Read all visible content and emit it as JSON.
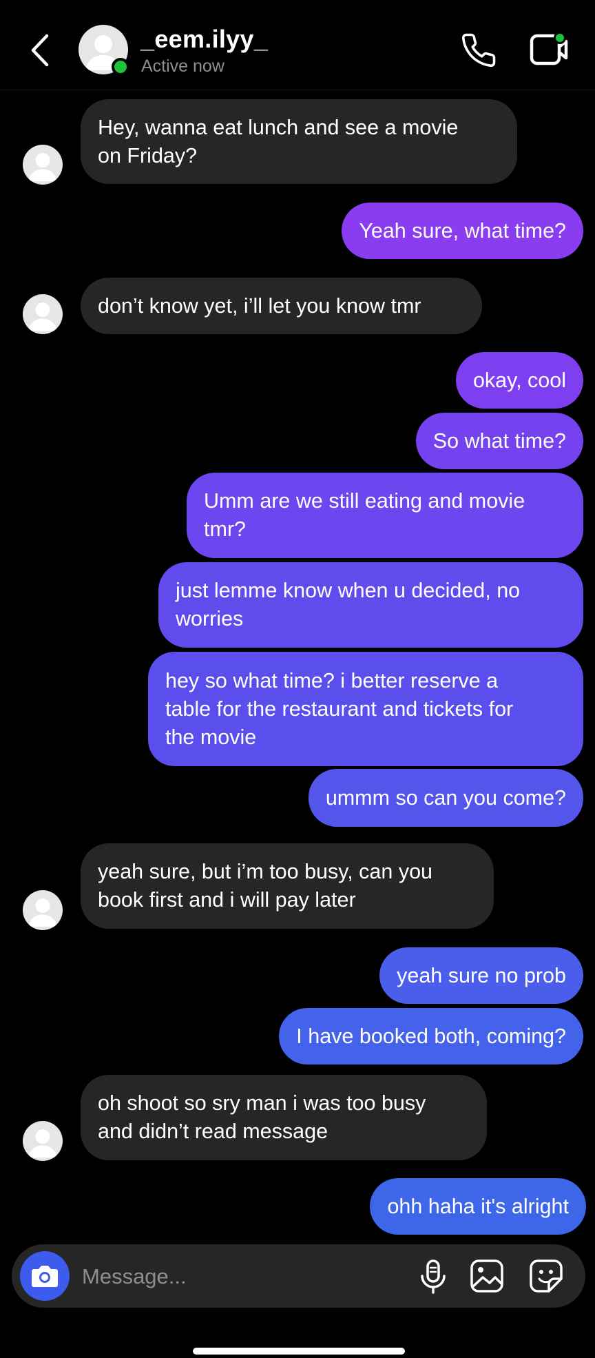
{
  "header": {
    "back_icon": "chevron-left-icon",
    "username": "_eem.ilyy_",
    "status": "Active now",
    "call_icon": "phone-icon",
    "video_icon": "video-camera-icon",
    "online_color": "#1fc33b"
  },
  "messages": [
    {
      "from": "them",
      "lines": [
        "Hey, wanna eat lunch and see a movie",
        "on Friday?"
      ]
    },
    {
      "from": "me",
      "lines": [
        "Yeah sure, what time?"
      ],
      "color": "#8a3cf0"
    },
    {
      "from": "them",
      "lines": [
        "don’t know yet, i’ll let you know tmr"
      ]
    },
    {
      "from": "me",
      "lines": [
        "okay, cool"
      ],
      "color": "#7d3ff0"
    },
    {
      "from": "me",
      "lines": [
        "So what time?"
      ],
      "color": "#7442ef"
    },
    {
      "from": "me",
      "lines": [
        "Umm are we still eating and movie",
        "tmr?"
      ],
      "color": "#6c46ee"
    },
    {
      "from": "me",
      "lines": [
        "just lemme know when u decided, no",
        "worries"
      ],
      "color": "#624bed"
    },
    {
      "from": "me",
      "lines": [
        "hey so what time? i better reserve a",
        "table for the restaurant and tickets for",
        "the movie"
      ],
      "color": "#5a4fec"
    },
    {
      "from": "me",
      "lines": [
        "ummm so can you come?"
      ],
      "color": "#5355eb"
    },
    {
      "from": "them",
      "lines": [
        "yeah sure, but i’m too busy, can you",
        "book first and i will pay later"
      ]
    },
    {
      "from": "me",
      "lines": [
        "yeah sure no prob"
      ],
      "color": "#4a5deb"
    },
    {
      "from": "me",
      "lines": [
        "I have booked both, coming?"
      ],
      "color": "#4562ea"
    },
    {
      "from": "them",
      "lines": [
        "oh shoot so sry man i was too busy",
        "and didn’t read message"
      ]
    },
    {
      "from": "me",
      "lines": [
        "ohh haha it's alright"
      ],
      "color": "#3d66e9"
    }
  ],
  "composer": {
    "placeholder": "Message...",
    "camera_icon": "camera-icon",
    "mic_icon": "microphone-icon",
    "gallery_icon": "image-icon",
    "sticker_icon": "sticker-icon"
  },
  "colors": {
    "received_bubble": "#262626",
    "background": "#000000",
    "accent": "#3d5bed"
  }
}
